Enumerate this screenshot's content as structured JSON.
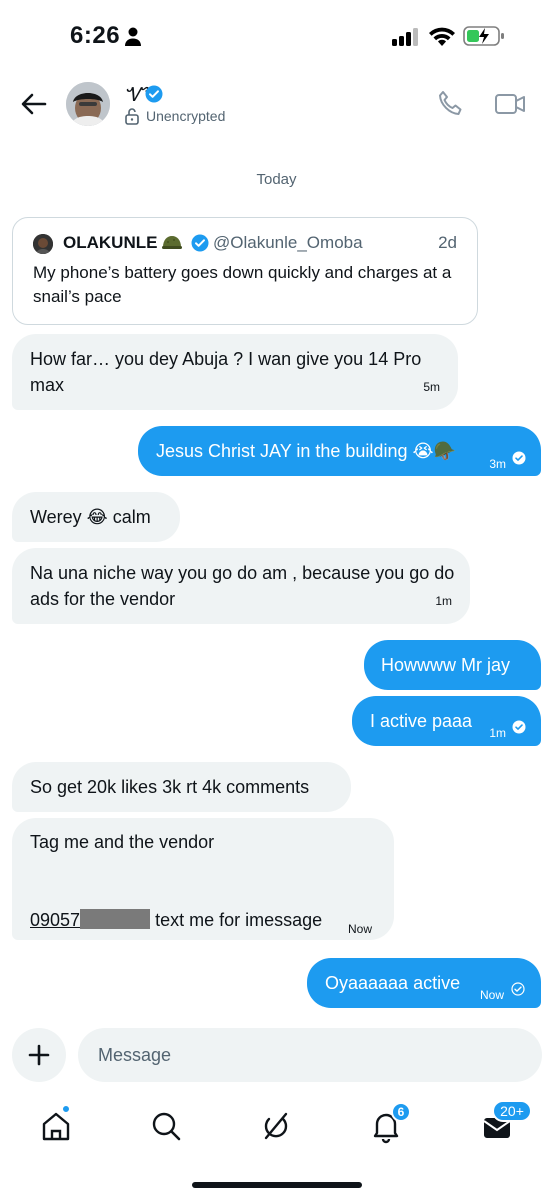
{
  "status_bar": {
    "time": "6:26"
  },
  "header": {
    "contact_name": "Ꮙ4",
    "encryption_status": "Unencrypted"
  },
  "date_divider": "Today",
  "quote": {
    "name": "OLAKUNLE",
    "handle": "@Olakunle_Omoba",
    "time": "2d",
    "text": "My phone’s battery goes down quickly and charges at a snail’s pace"
  },
  "messages": [
    {
      "text": "How far… you dey Abuja  ? I wan give you 14 Pro max",
      "time": "5m",
      "direction": "in"
    },
    {
      "text": "Jesus Christ JAY in the building 😭🪖",
      "time": "3m",
      "direction": "out"
    },
    {
      "text": "Werey 😂 calm",
      "time": "",
      "direction": "in"
    },
    {
      "text": "Na una niche way you go do am , because you go do ads for the vendor",
      "time": "1m",
      "direction": "in"
    },
    {
      "text": "Howwww Mr jay",
      "time": "",
      "direction": "out"
    },
    {
      "text": "I active paaa",
      "time": "1m",
      "direction": "out"
    },
    {
      "text": "So get 20k likes 3k rt 4k comments",
      "time": "",
      "direction": "in"
    },
    {
      "line1": "Tag me and the vendor",
      "phone": "09057",
      "line2": " text me for imessage",
      "time": "Now",
      "direction": "in"
    },
    {
      "text": "Oyaaaaaa active",
      "time": "Now",
      "direction": "out"
    }
  ],
  "composer": {
    "placeholder": "Message"
  },
  "nav": {
    "notifications_badge": "6",
    "messages_badge": "20+"
  },
  "colors": {
    "accent": "#1d9bf0",
    "incoming_bubble": "#eff3f4",
    "secondary_text": "#536471"
  }
}
